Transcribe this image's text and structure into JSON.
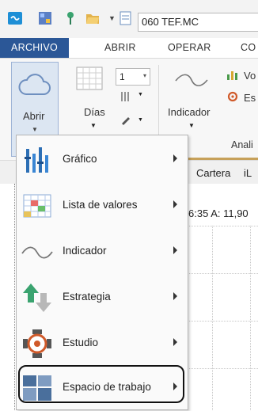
{
  "toolbar": {
    "symbol": "060 TEF.MC"
  },
  "menubar": {
    "tabs": [
      "ARCHIVO",
      "ABRIR",
      "OPERAR",
      "CO"
    ]
  },
  "ribbon": {
    "open_label": "Abrir",
    "days_label": "Días",
    "days_value": "1",
    "indicator_label": "Indicador",
    "text_vo": "Vo",
    "text_est": "Es",
    "group_label": "Anali"
  },
  "strip": {
    "tab_cartera": "Cartera",
    "tab_il": "iL"
  },
  "chart": {
    "header_text": "6:35  A: 11,90"
  },
  "dropdown": {
    "items": [
      {
        "label": "Gráfico",
        "icon": "chart-bars-icon"
      },
      {
        "label": "Lista de valores",
        "icon": "grid-list-icon"
      },
      {
        "label": "Indicador",
        "icon": "wave-indicator-icon"
      },
      {
        "label": "Estrategia",
        "icon": "up-down-arrows-icon"
      },
      {
        "label": "Estudio",
        "icon": "study-gear-icon"
      },
      {
        "label": "Espacio de trabajo",
        "icon": "workspace-layout-icon"
      }
    ]
  },
  "colors": {
    "active_tab": "#2b5797",
    "menu_bg": "#fafafa",
    "highlight_border": "#111111"
  }
}
